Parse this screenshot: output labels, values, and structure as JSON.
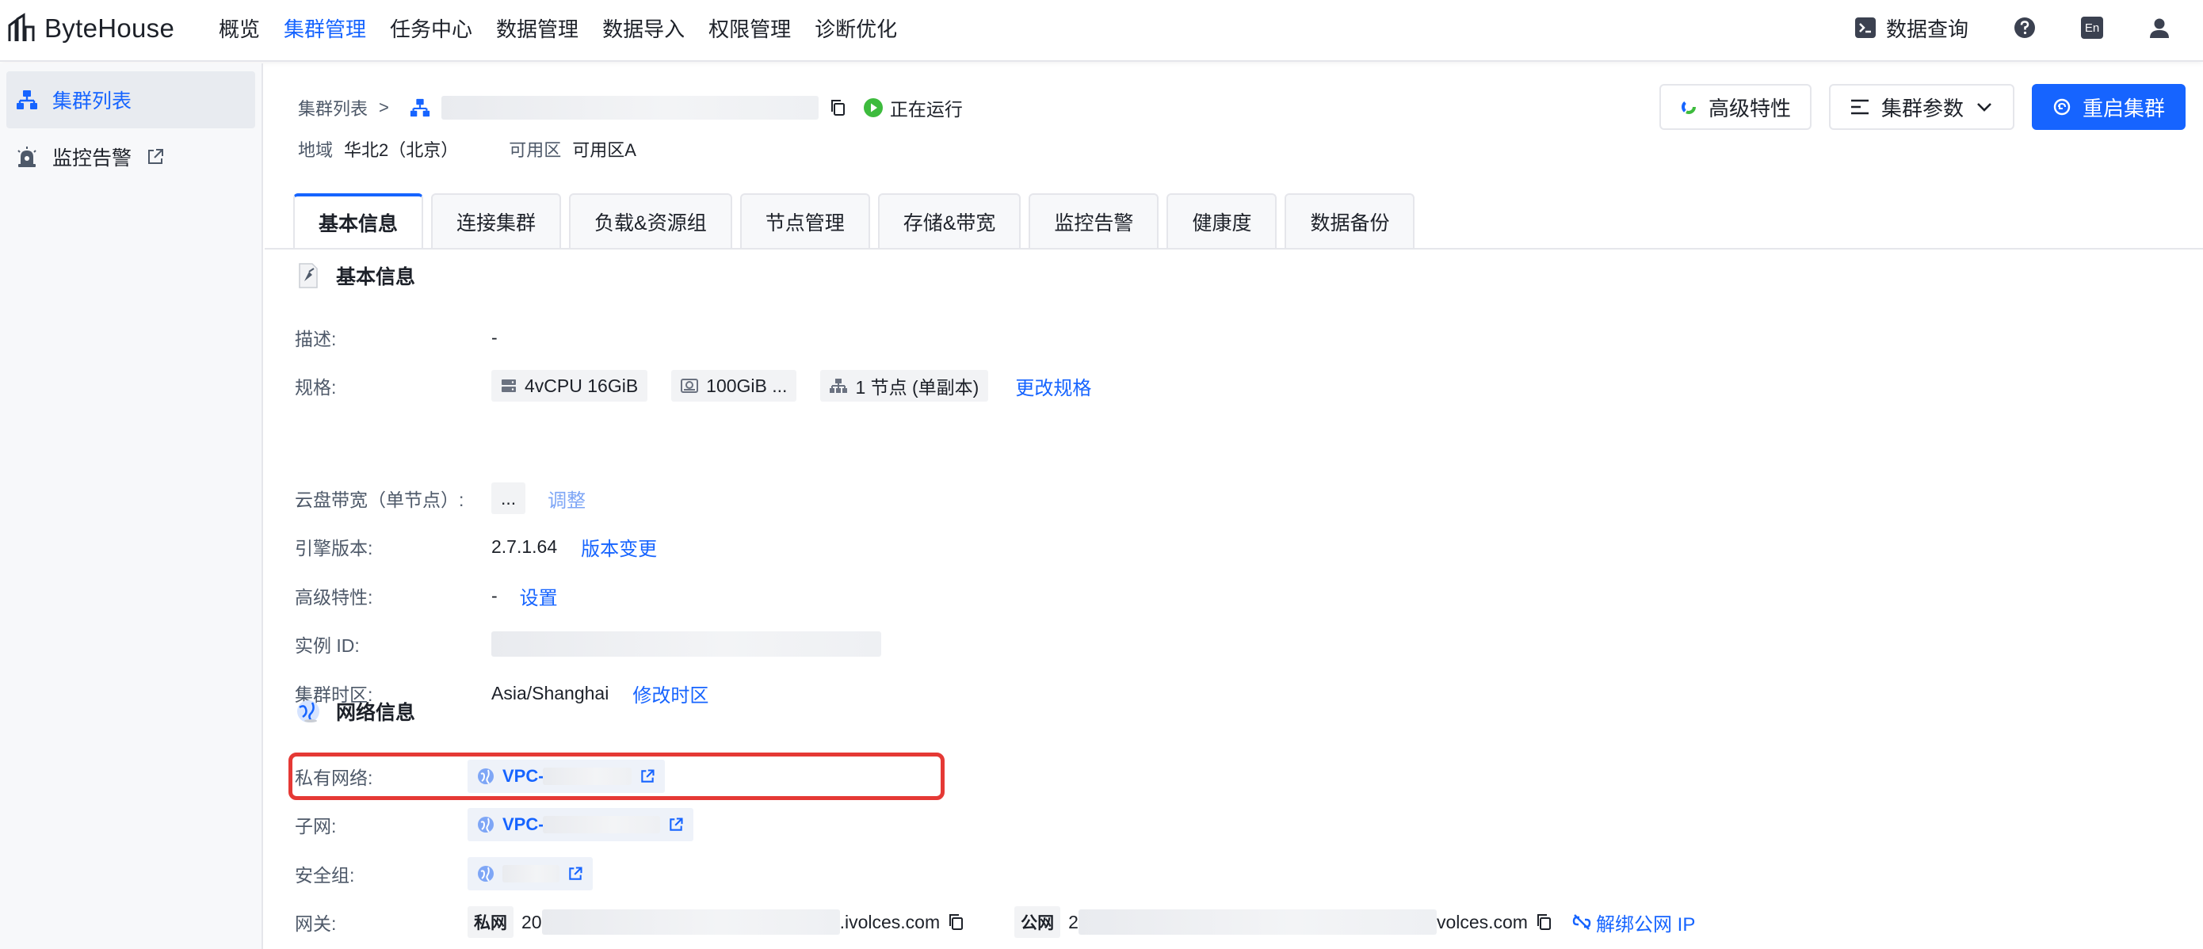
{
  "app": {
    "logo_text": "ByteHouse"
  },
  "colors": {
    "accent": "#1664ff",
    "running": "#3dbb3d",
    "highlight": "#e53935"
  },
  "nav": {
    "items": [
      {
        "label": "概览"
      },
      {
        "label": "集群管理",
        "active": true
      },
      {
        "label": "任务中心"
      },
      {
        "label": "数据管理"
      },
      {
        "label": "数据导入"
      },
      {
        "label": "权限管理"
      },
      {
        "label": "诊断优化"
      }
    ],
    "query_label": "数据查询",
    "lang_label": "En"
  },
  "sidebar": {
    "items": [
      {
        "label": "集群列表",
        "active": true
      },
      {
        "label": "监控告警"
      }
    ]
  },
  "header": {
    "breadcrumb_root": "集群列表",
    "separator": ">",
    "status": "正在运行",
    "region_label": "地域",
    "region_value": "华北2（北京）",
    "zone_label": "可用区",
    "zone_value": "可用区A"
  },
  "actions": {
    "advanced": "高级特性",
    "params": "集群参数",
    "restart": "重启集群"
  },
  "tabs": [
    {
      "label": "基本信息",
      "active": true
    },
    {
      "label": "连接集群"
    },
    {
      "label": "负载&资源组"
    },
    {
      "label": "节点管理"
    },
    {
      "label": "存储&带宽"
    },
    {
      "label": "监控告警"
    },
    {
      "label": "健康度"
    },
    {
      "label": "数据备份"
    }
  ],
  "basic": {
    "title": "基本信息",
    "desc_label": "描述:",
    "desc_value": "-",
    "spec_label": "规格:",
    "spec_cpu": "4vCPU 16GiB",
    "spec_disk": "100GiB ...",
    "spec_nodes": "1 节点 (单副本)",
    "spec_link": "更改规格",
    "bw_label": "云盘带宽（单节点）:",
    "bw_value": "...",
    "bw_link": "调整",
    "engine_label": "引擎版本:",
    "engine_value": "2.7.1.64",
    "engine_link": "版本变更",
    "adv_label": "高级特性:",
    "adv_value": "-",
    "adv_link": "设置",
    "id_label": "实例 ID:",
    "tz_label": "集群时区:",
    "tz_value": "Asia/Shanghai",
    "tz_link": "修改时区"
  },
  "network": {
    "title": "网络信息",
    "vpc_label": "私有网络:",
    "vpc_value": "VPC-",
    "subnet_label": "子网:",
    "subnet_value": "VPC-",
    "sg_label": "安全组:",
    "gw_label": "网关:",
    "private_tag": "私网",
    "private_prefix": "20",
    "private_suffix": ".ivolces.com",
    "public_tag": "公网",
    "public_prefix": "2",
    "public_suffix": "volces.com",
    "unbind_link": "解绑公网 IP"
  }
}
